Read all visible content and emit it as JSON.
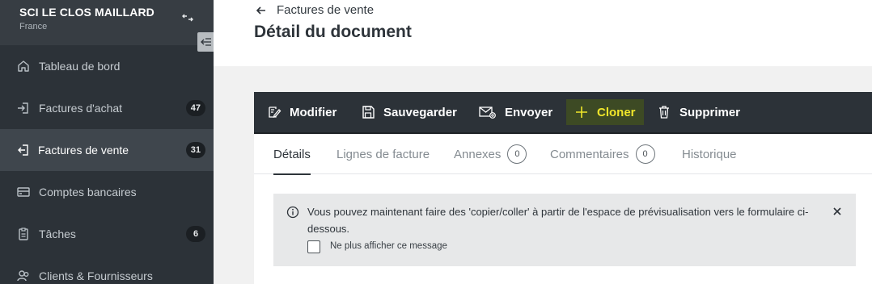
{
  "company": {
    "name": "SCI LE CLOS MAILLARD",
    "country": "France"
  },
  "nav": [
    {
      "label": "Tableau de bord",
      "icon": "home-icon",
      "badge": null
    },
    {
      "label": "Factures d'achat",
      "icon": "login-icon",
      "badge": "47"
    },
    {
      "label": "Factures de vente",
      "icon": "logout-icon",
      "badge": "31",
      "active": true
    },
    {
      "label": "Comptes bancaires",
      "icon": "credit-card-icon",
      "badge": null
    },
    {
      "label": "Tâches",
      "icon": "clipboard-icon",
      "badge": "6"
    },
    {
      "label": "Clients & Fournisseurs",
      "icon": "users-icon",
      "badge": null
    }
  ],
  "header": {
    "back_label": "Factures de vente",
    "title": "Détail du document"
  },
  "toolbar": [
    {
      "label": "Modifier",
      "icon": "edit-icon"
    },
    {
      "label": "Sauvegarder",
      "icon": "save-icon"
    },
    {
      "label": "Envoyer",
      "icon": "mail-at-icon"
    },
    {
      "label": "Cloner",
      "icon": "plus-icon",
      "highlighted": true
    },
    {
      "label": "Supprimer",
      "icon": "trash-icon"
    }
  ],
  "tabs": [
    {
      "label": "Détails",
      "active": true
    },
    {
      "label": "Lignes de facture"
    },
    {
      "label": "Annexes",
      "count": "0"
    },
    {
      "label": "Commentaires",
      "count": "0"
    },
    {
      "label": "Historique"
    }
  ],
  "notice": {
    "text": "Vous pouvez maintenant faire des 'copier/coller' à partir de l'espace de prévisualisation vers le formulaire ci-dessous.",
    "checkbox_label": "Ne plus afficher ce message",
    "checked": false
  },
  "colors": {
    "sidebar_bg": "#2c3238",
    "toolbar_bg": "#2c3238",
    "highlight_text": "#f0e62a"
  }
}
